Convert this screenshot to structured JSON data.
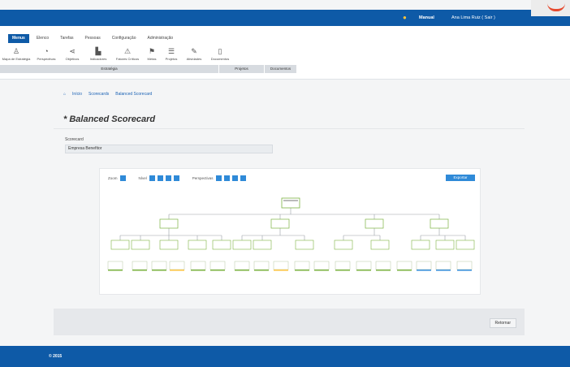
{
  "header": {
    "manual_label": "Manual",
    "user_label": "Ana Lima Ruiz ( Sair )"
  },
  "menu": {
    "tabs": [
      "Menus",
      "Elenco",
      "Tarefas",
      "Pessoas",
      "Configuração",
      "Administração"
    ],
    "ribbon": [
      {
        "label": "Mapa de Estratégia",
        "icon": "person-icon"
      },
      {
        "label": "Perspectivas",
        "icon": "pie-icon"
      },
      {
        "label": "Objetivos",
        "icon": "share-icon"
      },
      {
        "label": "Indicadores",
        "icon": "chart-icon"
      },
      {
        "label": "Fatores Críticos",
        "icon": "warning-icon"
      },
      {
        "label": "Metas",
        "icon": "flag-icon"
      },
      {
        "label": "Projetos",
        "icon": "list-icon"
      },
      {
        "label": "Atividades",
        "icon": "edit-icon"
      },
      {
        "label": "Documentos",
        "icon": "document-icon"
      }
    ],
    "groups": [
      "Estratégia",
      "Projetos",
      "Documentos"
    ]
  },
  "breadcrumb": [
    "Início",
    "Scorecards",
    "Balanced Scorecard"
  ],
  "page": {
    "title": "* Balanced Scorecard",
    "scorecard_label": "Scorecard",
    "scorecard_value": "Empresa Benefitor"
  },
  "chart_controls": {
    "labels": [
      "Zoom",
      "Nível",
      "Perspectivas"
    ],
    "export_label": "Exportar"
  },
  "footer": {
    "close_label": "Retornar",
    "copyright": "© 2015"
  },
  "colors": {
    "primary": "#0e5aa7",
    "accent": "#2f8ad8",
    "node_green": "#7cb342",
    "node_blue": "#2f8ad8"
  }
}
